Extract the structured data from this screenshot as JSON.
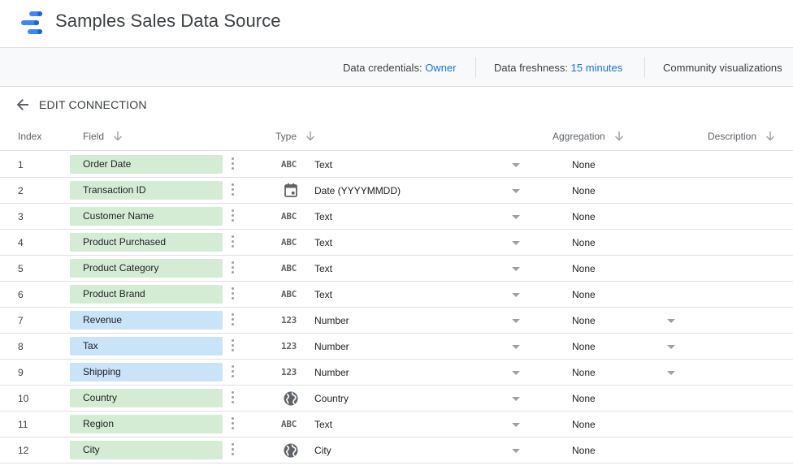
{
  "header": {
    "title": "Samples Sales Data Source",
    "logo_icon": "data-studio-logo-icon"
  },
  "infobar": {
    "credentials_label": "Data credentials:",
    "credentials_value": "Owner",
    "freshness_label": "Data freshness:",
    "freshness_value": "15 minutes",
    "community_label": "Community visualizations"
  },
  "edit_connection": {
    "label": "EDIT CONNECTION",
    "icon": "arrow-back-icon"
  },
  "table": {
    "columns": {
      "index": "Index",
      "field": "Field",
      "type": "Type",
      "aggregation": "Aggregation",
      "description": "Description"
    },
    "rows": [
      {
        "index": "1",
        "field": "Order Date",
        "kind": "dimension",
        "type_icon": "text",
        "type_glyph": "ABC",
        "type": "Text",
        "aggregation": "None",
        "agg_dropdown": false
      },
      {
        "index": "2",
        "field": "Transaction ID",
        "kind": "dimension",
        "type_icon": "calendar",
        "type_glyph": "",
        "type": "Date (YYYYMMDD)",
        "aggregation": "None",
        "agg_dropdown": false
      },
      {
        "index": "3",
        "field": "Customer Name",
        "kind": "dimension",
        "type_icon": "text",
        "type_glyph": "ABC",
        "type": "Text",
        "aggregation": "None",
        "agg_dropdown": false
      },
      {
        "index": "4",
        "field": "Product Purchased",
        "kind": "dimension",
        "type_icon": "text",
        "type_glyph": "ABC",
        "type": "Text",
        "aggregation": "None",
        "agg_dropdown": false
      },
      {
        "index": "5",
        "field": "Product Category",
        "kind": "dimension",
        "type_icon": "text",
        "type_glyph": "ABC",
        "type": "Text",
        "aggregation": "None",
        "agg_dropdown": false
      },
      {
        "index": "6",
        "field": "Product Brand",
        "kind": "dimension",
        "type_icon": "text",
        "type_glyph": "ABC",
        "type": "Text",
        "aggregation": "None",
        "agg_dropdown": false
      },
      {
        "index": "7",
        "field": "Revenue",
        "kind": "metric",
        "type_icon": "number",
        "type_glyph": "123",
        "type": "Number",
        "aggregation": "None",
        "agg_dropdown": true
      },
      {
        "index": "8",
        "field": "Tax",
        "kind": "metric",
        "type_icon": "number",
        "type_glyph": "123",
        "type": "Number",
        "aggregation": "None",
        "agg_dropdown": true
      },
      {
        "index": "9",
        "field": "Shipping",
        "kind": "metric",
        "type_icon": "number",
        "type_glyph": "123",
        "type": "Number",
        "aggregation": "None",
        "agg_dropdown": true
      },
      {
        "index": "10",
        "field": "Country",
        "kind": "dimension",
        "type_icon": "globe",
        "type_glyph": "",
        "type": "Country",
        "aggregation": "None",
        "agg_dropdown": false
      },
      {
        "index": "11",
        "field": "Region",
        "kind": "dimension",
        "type_icon": "text",
        "type_glyph": "ABC",
        "type": "Text",
        "aggregation": "None",
        "agg_dropdown": false
      },
      {
        "index": "12",
        "field": "City",
        "kind": "dimension",
        "type_icon": "globe",
        "type_glyph": "",
        "type": "City",
        "aggregation": "None",
        "agg_dropdown": false
      }
    ]
  },
  "colors": {
    "dimension_chip": "#d5ecd4",
    "metric_chip": "#c9e3f9",
    "link": "#1a73e8",
    "logo_blue": "#4285f4",
    "logo_dark": "#1967d2"
  }
}
